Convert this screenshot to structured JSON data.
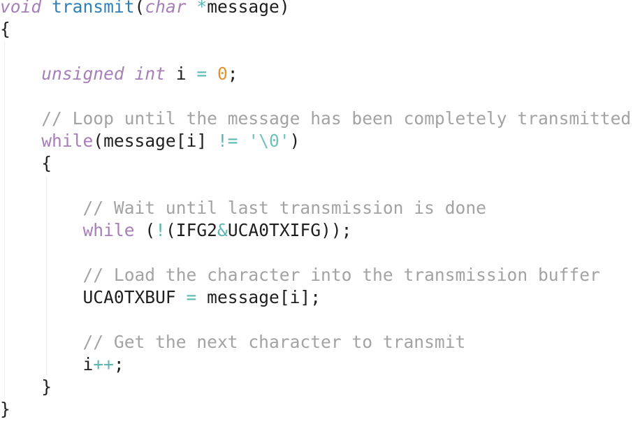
{
  "editor": {
    "lines": [
      {
        "tokens": [
          {
            "text": "void",
            "type": "tok-type"
          },
          {
            "text": " ",
            "type": "tok-plain"
          },
          {
            "text": "transmit",
            "type": "tok-fn"
          },
          {
            "text": "(",
            "type": "tok-plain"
          },
          {
            "text": "char",
            "type": "tok-type"
          },
          {
            "text": " ",
            "type": "tok-plain"
          },
          {
            "text": "*",
            "type": "tok-op"
          },
          {
            "text": "message)",
            "type": "tok-plain"
          }
        ]
      },
      {
        "tokens": [
          {
            "text": "{",
            "type": "tok-plain"
          }
        ]
      },
      {
        "tokens": []
      },
      {
        "tokens": [
          {
            "text": "    ",
            "type": "tok-plain"
          },
          {
            "text": "unsigned",
            "type": "tok-type"
          },
          {
            "text": " ",
            "type": "tok-plain"
          },
          {
            "text": "int",
            "type": "tok-type"
          },
          {
            "text": " i ",
            "type": "tok-plain"
          },
          {
            "text": "=",
            "type": "tok-op"
          },
          {
            "text": " ",
            "type": "tok-plain"
          },
          {
            "text": "0",
            "type": "tok-num"
          },
          {
            "text": ";",
            "type": "tok-plain"
          }
        ]
      },
      {
        "tokens": []
      },
      {
        "tokens": [
          {
            "text": "    ",
            "type": "tok-plain"
          },
          {
            "text": "// Loop until the message has been completely transmitted",
            "type": "tok-comment"
          }
        ]
      },
      {
        "tokens": [
          {
            "text": "    ",
            "type": "tok-plain"
          },
          {
            "text": "while",
            "type": "tok-kw"
          },
          {
            "text": "(message[i] ",
            "type": "tok-plain"
          },
          {
            "text": "!=",
            "type": "tok-op"
          },
          {
            "text": " ",
            "type": "tok-plain"
          },
          {
            "text": "'\\0'",
            "type": "tok-str"
          },
          {
            "text": ")",
            "type": "tok-plain"
          }
        ]
      },
      {
        "tokens": [
          {
            "text": "    ",
            "type": "tok-plain"
          },
          {
            "text": "{",
            "type": "tok-plain"
          }
        ]
      },
      {
        "tokens": []
      },
      {
        "tokens": [
          {
            "text": "        ",
            "type": "tok-plain"
          },
          {
            "text": "// Wait until last transmission is done",
            "type": "tok-comment"
          }
        ]
      },
      {
        "tokens": [
          {
            "text": "        ",
            "type": "tok-plain"
          },
          {
            "text": "while",
            "type": "tok-kw"
          },
          {
            "text": " (",
            "type": "tok-plain"
          },
          {
            "text": "!",
            "type": "tok-op"
          },
          {
            "text": "(IFG2",
            "type": "tok-plain"
          },
          {
            "text": "&",
            "type": "tok-op"
          },
          {
            "text": "UCA0TXIFG));",
            "type": "tok-plain"
          }
        ]
      },
      {
        "tokens": []
      },
      {
        "tokens": [
          {
            "text": "        ",
            "type": "tok-plain"
          },
          {
            "text": "// Load the character into the transmission buffer",
            "type": "tok-comment"
          }
        ]
      },
      {
        "tokens": [
          {
            "text": "        ",
            "type": "tok-plain"
          },
          {
            "text": "UCA0TXBUF ",
            "type": "tok-plain"
          },
          {
            "text": "=",
            "type": "tok-op"
          },
          {
            "text": " message[i];",
            "type": "tok-plain"
          }
        ]
      },
      {
        "tokens": []
      },
      {
        "tokens": [
          {
            "text": "        ",
            "type": "tok-plain"
          },
          {
            "text": "// Get the next character to transmit",
            "type": "tok-comment"
          }
        ]
      },
      {
        "tokens": [
          {
            "text": "        ",
            "type": "tok-plain"
          },
          {
            "text": "i",
            "type": "tok-plain"
          },
          {
            "text": "++",
            "type": "tok-op"
          },
          {
            "text": ";",
            "type": "tok-plain"
          }
        ]
      },
      {
        "tokens": [
          {
            "text": "    ",
            "type": "tok-plain"
          },
          {
            "text": "}",
            "type": "tok-plain"
          }
        ]
      },
      {
        "tokens": [
          {
            "text": "}",
            "type": "tok-plain"
          }
        ]
      }
    ],
    "colors": {
      "keyword": "#a77fb8",
      "function": "#2f80b8",
      "number": "#e3932f",
      "operator": "#5cb7b0",
      "string": "#6fc2b8",
      "comment": "#a3a3a3",
      "text": "#1f1f1f",
      "indent_guide": "#eeeeee"
    }
  }
}
